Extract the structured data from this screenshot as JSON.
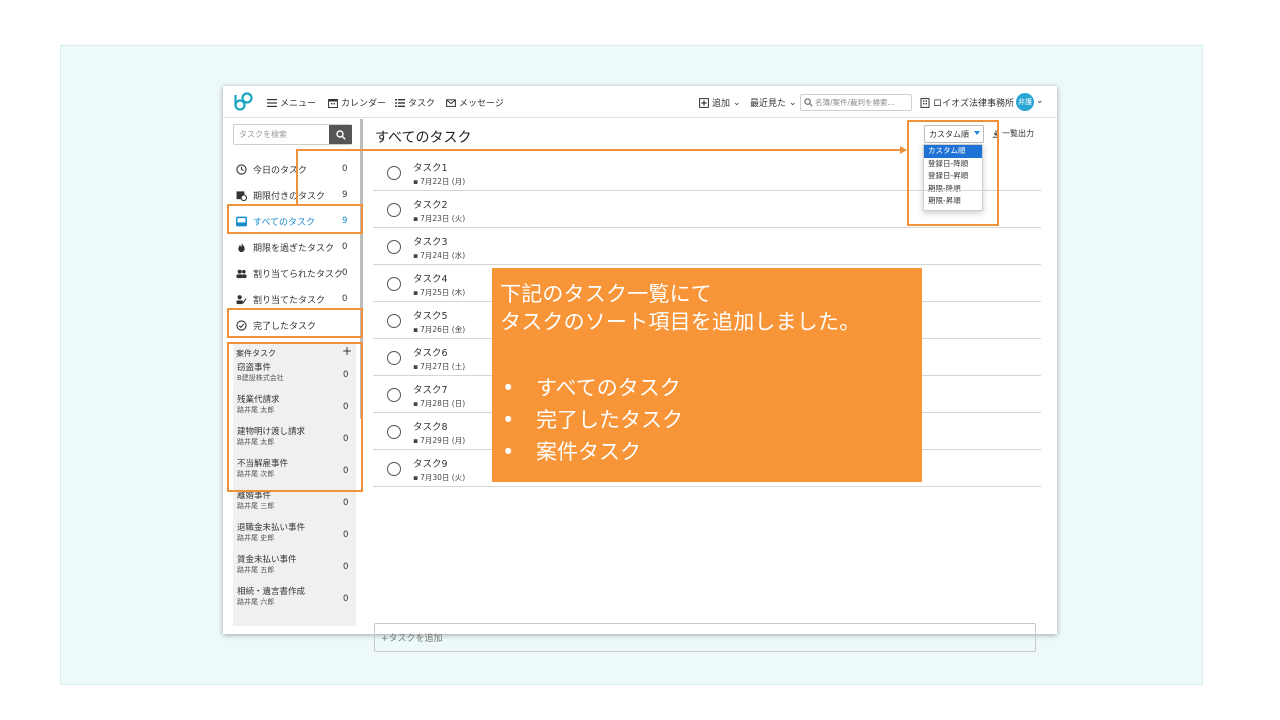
{
  "topbar": {
    "menu_label": "メニュー",
    "calendar_label": "カレンダー",
    "task_label": "タスク",
    "message_label": "メッセージ",
    "add_label": "追加",
    "recent_label": "最近見た",
    "search_placeholder": "名簿/案件/裁判を検索...",
    "office_name": "ロイオズ法律事務所",
    "avatar_text": "弁護"
  },
  "sidebar": {
    "search_placeholder": "タスクを検索",
    "items": [
      {
        "label": "今日のタスク",
        "count": "0",
        "icon": "clock-icon"
      },
      {
        "label": "期限付きのタスク",
        "count": "9",
        "icon": "calendar-clock-icon"
      },
      {
        "label": "すべてのタスク",
        "count": "9",
        "icon": "inbox-icon",
        "active": true
      },
      {
        "label": "期限を過ぎたタスク",
        "count": "0",
        "icon": "fire-icon"
      },
      {
        "label": "割り当てられたタスク",
        "count": "0",
        "icon": "users-icon"
      },
      {
        "label": "割り当てたタスク",
        "count": "0",
        "icon": "user-assign-icon"
      },
      {
        "label": "完了したタスク",
        "count": "",
        "icon": "check-circle-icon"
      }
    ],
    "case_header": "案件タスク",
    "case_add": "+",
    "cases": [
      {
        "name": "窃盗事件",
        "client": "B建設株式会社",
        "count": "0"
      },
      {
        "name": "残業代請求",
        "client": "路井尾 太郎",
        "count": "0"
      },
      {
        "name": "建物明け渡し請求",
        "client": "路井尾 太郎",
        "count": "0"
      },
      {
        "name": "不当解雇事件",
        "client": "路井尾 次郎",
        "count": "0"
      },
      {
        "name": "離婚事件",
        "client": "路井尾 三郎",
        "count": "0"
      },
      {
        "name": "退職金未払い事件",
        "client": "路井尾 史郎",
        "count": "0"
      },
      {
        "name": "賃金未払い事件",
        "client": "路井尾 五郎",
        "count": "0"
      },
      {
        "name": "相続・遺言書作成",
        "client": "路井尾 六郎",
        "count": "0"
      }
    ]
  },
  "main": {
    "title": "すべてのタスク",
    "sort_selected": "カスタム順",
    "export_label": "一覧出力",
    "sort_options": [
      "カスタム順",
      "登録日-降順",
      "登録日-昇順",
      "期限-降順",
      "期限-昇順"
    ],
    "tasks": [
      {
        "name": "タスク1",
        "date": "7月22日 (月)"
      },
      {
        "name": "タスク2",
        "date": "7月23日 (火)"
      },
      {
        "name": "タスク3",
        "date": "7月24日 (水)"
      },
      {
        "name": "タスク4",
        "date": "7月25日 (木)"
      },
      {
        "name": "タスク5",
        "date": "7月26日 (金)"
      },
      {
        "name": "タスク6",
        "date": "7月27日 (土)"
      },
      {
        "name": "タスク7",
        "date": "7月28日 (日)"
      },
      {
        "name": "タスク8",
        "date": "7月29日 (月)"
      },
      {
        "name": "タスク9",
        "date": "7月30日 (火)"
      }
    ],
    "add_task_placeholder": "+タスクを追加"
  },
  "callout": {
    "line1": "下記のタスク一覧にて",
    "line2": "タスクのソート項目を追加しました。",
    "bullet_char": "•",
    "bullets": [
      "すべてのタスク",
      "完了したタスク",
      "案件タスク"
    ]
  },
  "colors": {
    "accent": "#1b8bc9",
    "highlight": "#f0923a",
    "callout_bg": "#f79538",
    "panel_bg": "#eefafa"
  }
}
